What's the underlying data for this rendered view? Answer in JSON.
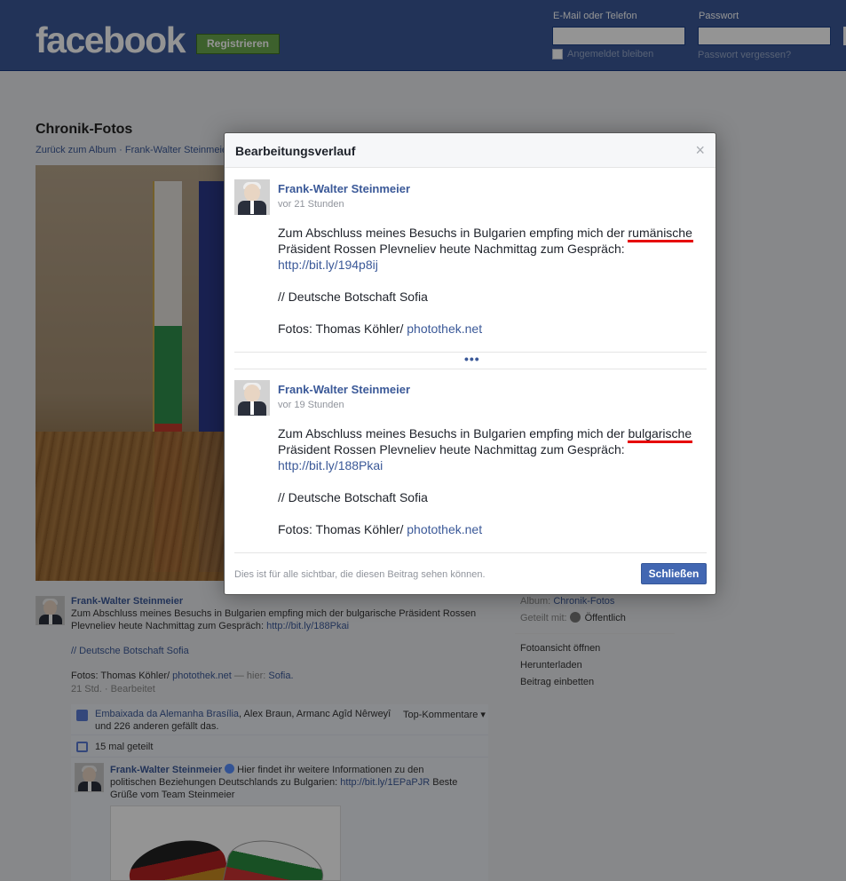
{
  "header": {
    "logo": "facebook",
    "register_label": "Registrieren",
    "email_label": "E-Mail oder Telefon",
    "password_label": "Passwort",
    "email_value": "",
    "password_value": "",
    "keep_logged_in": "Angemeldet bleiben",
    "forgot_password": "Passwort vergessen?"
  },
  "page": {
    "title": "Chronik-Fotos",
    "crumb_back": "Zurück zum Album",
    "crumb_sep": " · ",
    "crumb_author": "Frank-Walter Steinmeier"
  },
  "post": {
    "author": "Frank-Walter Steinmeier",
    "text_line1": "Zum Abschluss meines Besuchs in Bulgarien empfing mich der bulgarische Präsident Rossen",
    "text_line2": "Plevneliev heute Nachmittag zum Gespräch: ",
    "link": "http://bit.ly/188Pkai",
    "embassy": "// Deutsche Botschaft Sofia",
    "photos_prefix": "Fotos: Thomas Köhler/ ",
    "photos_link": "photothek.net",
    "photos_sep": " — hier: ",
    "photos_place": "Sofia.",
    "time": "21 Std.",
    "time_sep": " · ",
    "edited": "Bearbeitet",
    "likes_names": "Embaixada da Alemanha Brasília",
    "likes_rest": ", Alex Braun, Armanc Agîd Nêrweyî",
    "likes_line2": "und 226 anderen gefällt das.",
    "top_comments": "Top-Kommentare ▾",
    "shares": "15 mal geteilt",
    "comment_author": "Frank-Walter Steinmeier",
    "comment_text1": "Hier findet ihr weitere Informationen zu den",
    "comment_text2": "politischen Beziehungen Deutschlands zu Bulgarien: ",
    "comment_link": "http://bit.ly/1EPaPJR",
    "comment_text2b": " Beste",
    "comment_text3": "Grüße vom Team Steinmeier"
  },
  "sidebar": {
    "album_label": "Album:",
    "album_value": "Chronik-Fotos",
    "shared_label": "Geteilt mit:",
    "shared_value": "Öffentlich",
    "action1": "Fotoansicht öffnen",
    "action2": "Herunterladen",
    "action3": "Beitrag einbetten"
  },
  "dialog": {
    "title": "Bearbeitungsverlauf",
    "close_icon": "×",
    "more": "•••",
    "footer_text": "Dies ist für alle sichtbar, die diesen Beitrag sehen können.",
    "close_button": "Schließen",
    "entries": [
      {
        "name": "Frank-Walter Steinmeier",
        "time": "vor 21 Stunden",
        "line1_pre": "Zum Abschluss meines Besuchs in Bulgarien empfing mich der ",
        "line1_highlight": "rumänische",
        "line2": "Präsident Rossen Plevneliev heute Nachmittag zum Gespräch:",
        "link": "http://bit.ly/194p8ij",
        "embassy": "// Deutsche Botschaft Sofia",
        "photos_prefix": "Fotos: Thomas Köhler/ ",
        "photos_link": "photothek.net"
      },
      {
        "name": "Frank-Walter Steinmeier",
        "time": "vor 19 Stunden",
        "line1_pre": "Zum Abschluss meines Besuchs in Bulgarien empfing mich der ",
        "line1_highlight": "bulgarische",
        "line2": "Präsident Rossen Plevneliev heute Nachmittag zum Gespräch:",
        "link": "http://bit.ly/188Pkai",
        "embassy": "// Deutsche Botschaft Sofia",
        "photos_prefix": "Fotos: Thomas Köhler/ ",
        "photos_link": "photothek.net"
      }
    ]
  },
  "colors": {
    "brand_blue": "#3b5998",
    "register_green": "#69a74e",
    "highlight_red": "#e60000",
    "button_blue": "#4267b2"
  }
}
